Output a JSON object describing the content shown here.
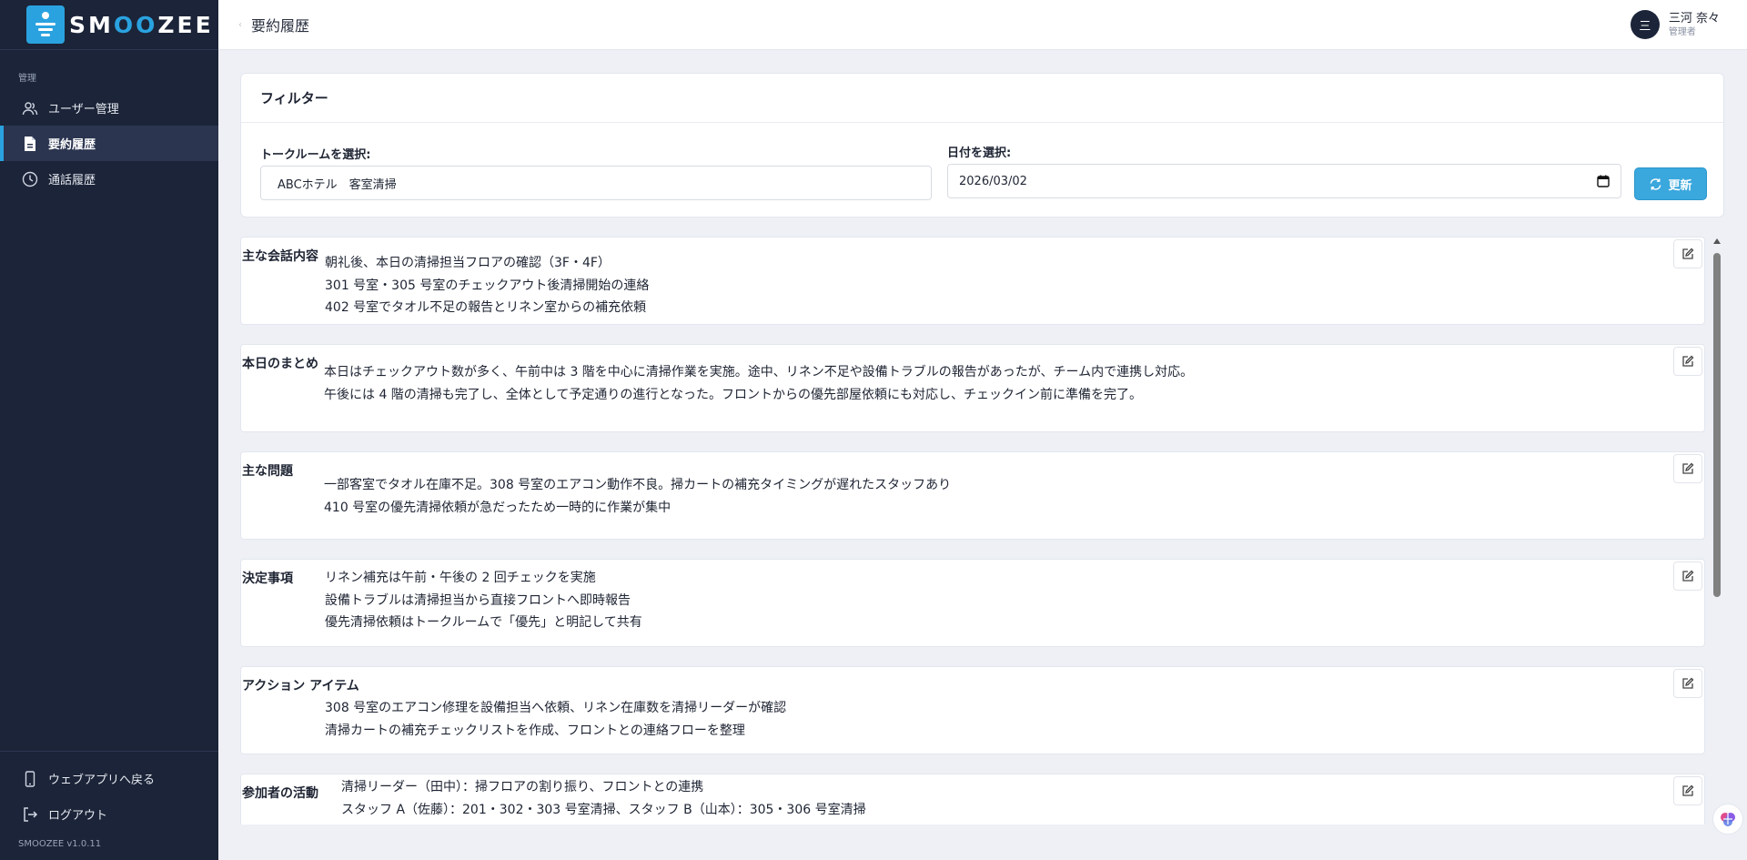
{
  "brand": {
    "prefix": "SM",
    "oo": "OO",
    "suffix": "ZEE"
  },
  "sidebar": {
    "section_label": "管理",
    "items": [
      {
        "label": "ユーザー管理",
        "icon": "users-icon"
      },
      {
        "label": "要約履歴",
        "icon": "document-icon",
        "active": true
      },
      {
        "label": "通話履歴",
        "icon": "clock-icon"
      }
    ],
    "footer": [
      {
        "label": "ウェブアプリへ戻る",
        "icon": "phone-icon"
      },
      {
        "label": "ログアウト",
        "icon": "logout-icon"
      }
    ],
    "version": "SMOOZEE v1.0.11"
  },
  "header": {
    "title": "要約履歴",
    "user": {
      "initial": "三",
      "name": "三河 奈々",
      "role": "管理者"
    }
  },
  "filter": {
    "title": "フィルター",
    "room_label": "トークルームを選択:",
    "room_value": "ABCホテル　客室清掃",
    "date_label": "日付を選択:",
    "date_value": "2026/03/02",
    "refresh_label": "更新"
  },
  "summaries": [
    {
      "title": "主な会話内容",
      "lines": [
        "朝礼後、本日の清掃担当フロアの確認（3F・4F）",
        "301 号室・305 号室のチェックアウト後清掃開始の連絡",
        "402 号室でタオル不足の報告とリネン室からの補充依頼"
      ]
    },
    {
      "title": "本日のまとめ",
      "lines": [
        "本日はチェックアウト数が多く、午前中は 3 階を中心に清掃作業を実施。途中、リネン不足や設備トラブルの報告があったが、チーム内で連携し対応。",
        "午後には 4 階の清掃も完了し、全体として予定通りの進行となった。フロントからの優先部屋依頼にも対応し、チェックイン前に準備を完了。"
      ]
    },
    {
      "title": "主な問題",
      "lines": [
        "一部客室でタオル在庫不足。308 号室のエアコン動作不良。掃カートの補充タイミングが遅れたスタッフあり",
        "410 号室の優先清掃依頼が急だったため一時的に作業が集中"
      ]
    },
    {
      "title": "決定事項",
      "lines": [
        "リネン補充は午前・午後の 2 回チェックを実施",
        "設備トラブルは清掃担当から直接フロントへ即時報告",
        "優先清掃依頼はトークルームで「優先」と明記して共有"
      ]
    },
    {
      "title": "アクション アイテム",
      "lines": [
        "308 号室のエアコン修理を設備担当へ依頼、リネン在庫数を清掃リーダーが確認",
        "清掃カートの補充チェックリストを作成、フロントとの連絡フローを整理"
      ]
    },
    {
      "title": "参加者の活動",
      "lines": [
        "清掃リーダー（田中）：掃フロアの割り振り、フロントとの連携",
        "スタッフ A（佐藤）：201・302・303 号室清掃、スタッフ B（山本）：305・306 号室清掃"
      ]
    }
  ]
}
